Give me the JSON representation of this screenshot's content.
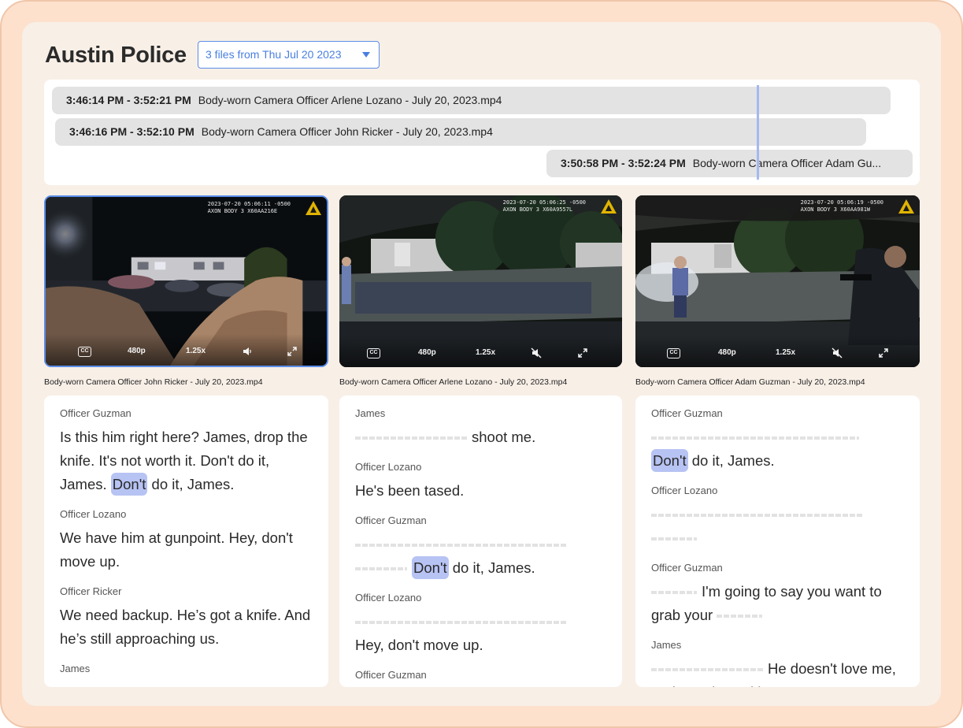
{
  "header": {
    "title": "Austin Police",
    "file_selector": "3 files from Thu Jul 20 2023"
  },
  "timeline": {
    "tracks": [
      {
        "range": "3:46:14 PM - 3:52:21 PM",
        "file": "Body-worn Camera Officer Arlene Lozano - July 20, 2023.mp4"
      },
      {
        "range": "3:46:16 PM - 3:52:10 PM",
        "file": "Body-worn Camera Officer John Ricker - July 20, 2023.mp4"
      },
      {
        "range": "3:50:58 PM - 3:52:24 PM",
        "file": "Body-worn Camera Officer Adam Gu..."
      }
    ]
  },
  "videos": [
    {
      "stamp_line1": "2023-07-20 05:06:11 -0500",
      "stamp_line2": "AXON BODY 3 X60AA216E",
      "quality": "480p",
      "speed": "1.25x",
      "muted": false,
      "caption": "Body-worn Camera Officer John Ricker - July 20, 2023.mp4"
    },
    {
      "stamp_line1": "2023-07-20 05:06:25 -0500",
      "stamp_line2": "AXON BODY 3 X60A9557L",
      "quality": "480p",
      "speed": "1.25x",
      "muted": true,
      "caption": "Body-worn Camera Officer Arlene Lozano - July 20, 2023.mp4"
    },
    {
      "stamp_line1": "2023-07-20 05:06:19 -0500",
      "stamp_line2": "AXON BODY 3 X60AA981W",
      "quality": "480p",
      "speed": "1.25x",
      "muted": true,
      "caption": "Body-worn Camera Officer Adam Guzman - July 20, 2023.mp4"
    }
  ],
  "transcripts": [
    {
      "entries": [
        {
          "speaker": "Officer Guzman",
          "text_before": "Is this him right here? James, drop the knife. It's not worth it. Don't do it, James. ",
          "highlight": "Don't",
          "text_after": " do it, James."
        },
        {
          "speaker": "Officer Lozano",
          "text": "We have him at gunpoint. Hey, don't move up."
        },
        {
          "speaker": "Officer Ricker",
          "text": "We need backup. He’s got a knife. And he’s still approaching us."
        },
        {
          "speaker": "James"
        }
      ]
    },
    {
      "entries": [
        {
          "speaker": "James",
          "text": "shoot me."
        },
        {
          "speaker": "Officer Lozano",
          "text": "He's been tased."
        },
        {
          "speaker": "Officer Guzman",
          "highlight": "Don't",
          "text_after": " do it, James."
        },
        {
          "speaker": "Officer Lozano",
          "text": "Hey, don't move up."
        },
        {
          "speaker": "Officer Guzman"
        }
      ]
    },
    {
      "entries": [
        {
          "speaker": "Officer Guzman",
          "highlight": "Don't",
          "text_after": " do it, James."
        },
        {
          "speaker": "Officer Lozano"
        },
        {
          "speaker": "Officer Guzman",
          "text_a": "I'm going to say you want to grab your"
        },
        {
          "speaker": "James",
          "text_a": "He doesn't love me, and you don't either."
        }
      ]
    }
  ],
  "colors": {
    "accent": "#5b8de8",
    "highlight": "#b7c3f3",
    "frame": "#fde1cd",
    "panel": "#f8efe7"
  }
}
